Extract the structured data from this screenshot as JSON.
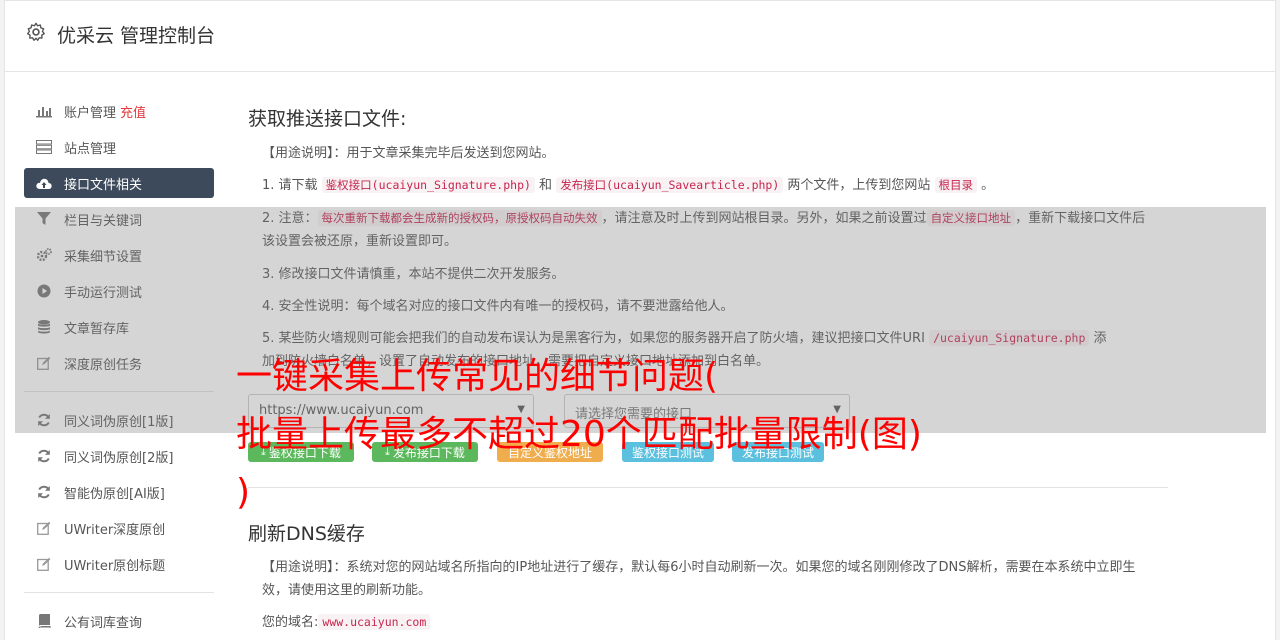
{
  "header": {
    "title": "优采云 管理控制台"
  },
  "sidebar": {
    "items": [
      {
        "label": "账户管理",
        "badge": "充值",
        "icon": "bar-chart-icon"
      },
      {
        "label": "站点管理",
        "icon": "server-icon"
      },
      {
        "label": "接口文件相关",
        "icon": "cloud-upload-icon"
      },
      {
        "label": "栏目与关键词",
        "icon": "filter-icon"
      },
      {
        "label": "采集细节设置",
        "icon": "cogs-icon"
      },
      {
        "label": "手动运行测试",
        "icon": "play-icon"
      },
      {
        "label": "文章暂存库",
        "icon": "database-icon"
      },
      {
        "label": "深度原创任务",
        "icon": "edit-icon"
      },
      {
        "label": "同义词伪原创[1版]",
        "icon": "refresh-icon"
      },
      {
        "label": "同义词伪原创[2版]",
        "icon": "refresh-icon"
      },
      {
        "label": "智能伪原创[AI版]",
        "icon": "refresh-icon"
      },
      {
        "label": "UWriter深度原创",
        "icon": "edit-icon"
      },
      {
        "label": "UWriter原创标题",
        "icon": "edit-icon"
      },
      {
        "label": "公有词库查询",
        "icon": "book-icon"
      }
    ]
  },
  "section1": {
    "title": "获取推送接口文件:",
    "usage_label": "【用途说明】",
    "usage_text": "：用于文章采集完毕后发送到您网站。",
    "step1": {
      "a": "1. 请下载 ",
      "code1": "鉴权接口(ucaiyun_Signature.php)",
      "b": " 和 ",
      "code2": "发布接口(ucaiyun_Savearticle.php)",
      "c": " 两个文件，上传到您网站 ",
      "code3": "根目录",
      "d": " 。"
    },
    "step2": {
      "a": "2. 注意：",
      "code1": "每次重新下载都会生成新的授权码，原授权码自动失效",
      "b": "，请注意及时上传到网站根目录。另外，如果之前设置过",
      "code2": "自定义接口地址",
      "c": "，重新下载接口文件后该设置会被还原，重新设置即可。"
    },
    "step3": "3. 修改接口文件请慎重，本站不提供二次开发服务。",
    "step4": "4. 安全性说明：每个域名对应的接口文件内有唯一的授权码，请不要泄露给他人。",
    "step5": {
      "a": "5. 某些防火墙规则可能会把我们的自动发布误认为是黑客行为，如果您的服务器开启了防火墙，建议把接口文件URI ",
      "code1": "/ucaiyun_Signature.php",
      "b": " 添",
      "c": "加到防火墙白名单，设置了自动发布的接口地址，需要把自定义接口地址添加到白名单。"
    },
    "site_value": "https://www.ucaiyun.com",
    "interface_placeholder": "请选择您需要的接口",
    "buttons": {
      "sign_download": "鉴权接口下载",
      "publish_download": "发布接口下载",
      "custom_sign": "自定义鉴权地址",
      "sign_test": "鉴权接口测试",
      "publish_test": "发布接口测试"
    }
  },
  "section2": {
    "title": "刷新DNS缓存",
    "usage_label": "【用途说明】",
    "usage_text": "：系统对您的网站域名所指向的IP地址进行了缓存，默认每6小时自动刷新一次。如果您的域名刚刚修改了DNS解析，需要在本系统中立即生效，请使用这里的刷新功能。",
    "domain_label": "您的域名:",
    "domain_value": "www.ucaiyun.com"
  },
  "overlay": {
    "line1": "一键采集上传常见的细节问题(",
    "line2": "批量上传最多不超过20个匹配批量限制(图)",
    "line3": ")"
  },
  "colors": {
    "active_nav": "#3d4a5c",
    "green": "#5cb85c",
    "orange": "#f0ad4e",
    "blue": "#5bc0de",
    "overlay_text": "#ff0000"
  }
}
